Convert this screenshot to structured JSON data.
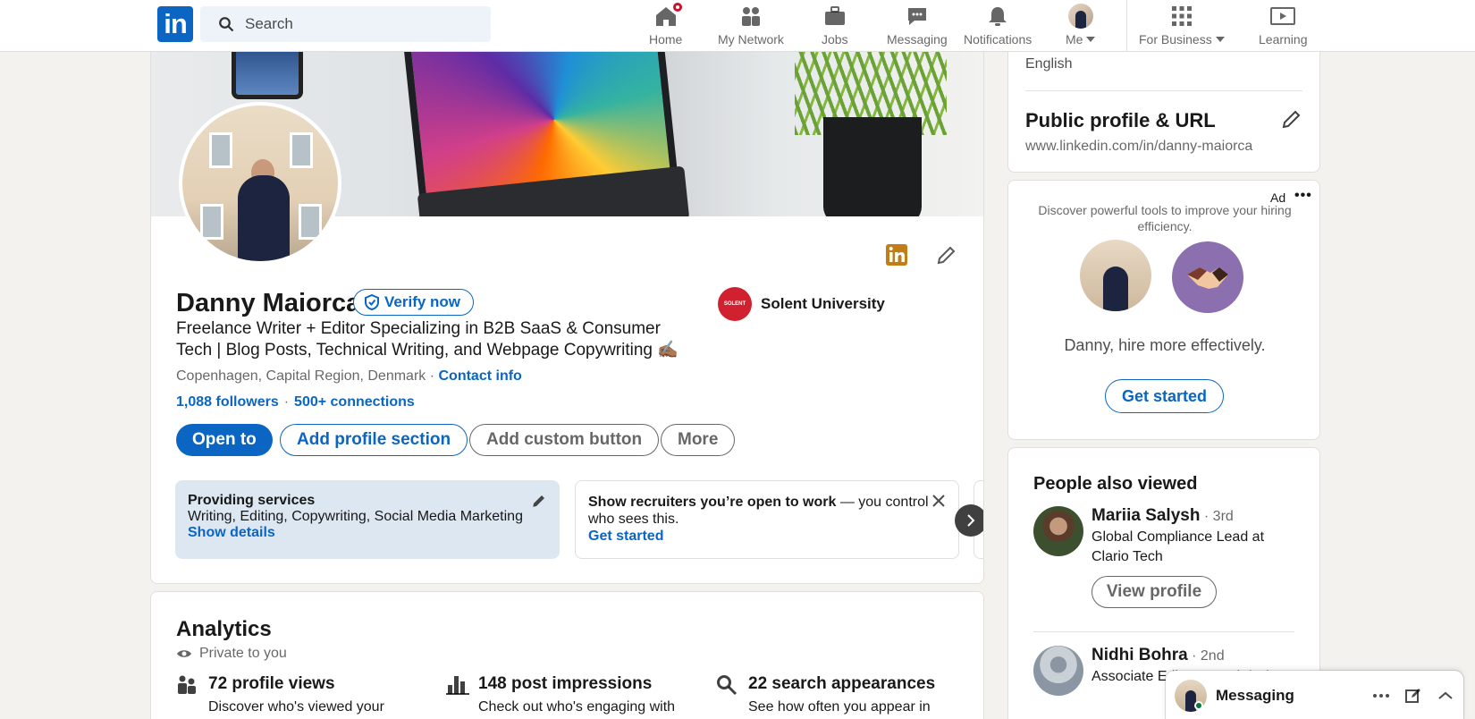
{
  "nav": {
    "search_placeholder": "Search",
    "items": [
      {
        "label": "Home",
        "icon": "home-icon"
      },
      {
        "label": "My Network",
        "icon": "people-icon"
      },
      {
        "label": "Jobs",
        "icon": "briefcase-icon"
      },
      {
        "label": "Messaging",
        "icon": "chat-icon"
      },
      {
        "label": "Notifications",
        "icon": "bell-icon"
      },
      {
        "label": "Me",
        "icon": "avatar"
      },
      {
        "label": "For Business",
        "icon": "grid-icon"
      },
      {
        "label": "Learning",
        "icon": "play-icon"
      }
    ]
  },
  "profile": {
    "name": "Danny Maiorca",
    "verify_label": "Verify now",
    "headline": "Freelance Writer + Editor Specializing in B2B SaaS & Consumer Tech | Blog Posts, Technical Writing, and Webpage Copywriting ✍🏾",
    "location": "Copenhagen, Capital Region, Denmark",
    "contact_info": "Contact info",
    "followers": "1,088 followers",
    "connections": "500+ connections",
    "school": "Solent University",
    "school_logo_text": "SOLENT",
    "buttons": {
      "open_to": "Open to",
      "add_section": "Add profile section",
      "add_custom": "Add custom button",
      "more": "More"
    },
    "services": {
      "title": "Providing services",
      "detail": "Writing, Editing, Copywriting, Social Media Marketing",
      "link": "Show details"
    },
    "recruiters": {
      "bold": "Show recruiters you’re open to work",
      "rest": " — you control who sees this.",
      "link": "Get started"
    }
  },
  "analytics": {
    "title": "Analytics",
    "privacy": "Private to you",
    "items": [
      {
        "headline": "72 profile views",
        "sub": "Discover who's viewed your"
      },
      {
        "headline": "148 post impressions",
        "sub": "Check out who's engaging with"
      },
      {
        "headline": "22 search appearances",
        "sub": "See how often you appear in"
      }
    ]
  },
  "rail": {
    "language": "English",
    "public_title": "Public profile & URL",
    "public_url": "www.linkedin.com/in/danny-maiorca"
  },
  "ad": {
    "label": "Ad",
    "text": "Discover powerful tools to improve your hiring efficiency.",
    "message": "Danny, hire more effectively.",
    "button": "Get started"
  },
  "people_also_viewed": {
    "title": "People also viewed",
    "people": [
      {
        "name": "Mariia Salysh",
        "degree": "· 3rd",
        "headline": "Global Compliance Lead at Clario Tech",
        "button": "View profile"
      },
      {
        "name": "Nidhi Bohra",
        "degree": "· 2nd",
        "headline": "Associate Editor at Tech | Blogs"
      }
    ]
  },
  "messaging": {
    "label": "Messaging"
  },
  "colors": {
    "brand": "#0a66c2",
    "badge": "#cb112d",
    "background": "#f4f2ee"
  }
}
